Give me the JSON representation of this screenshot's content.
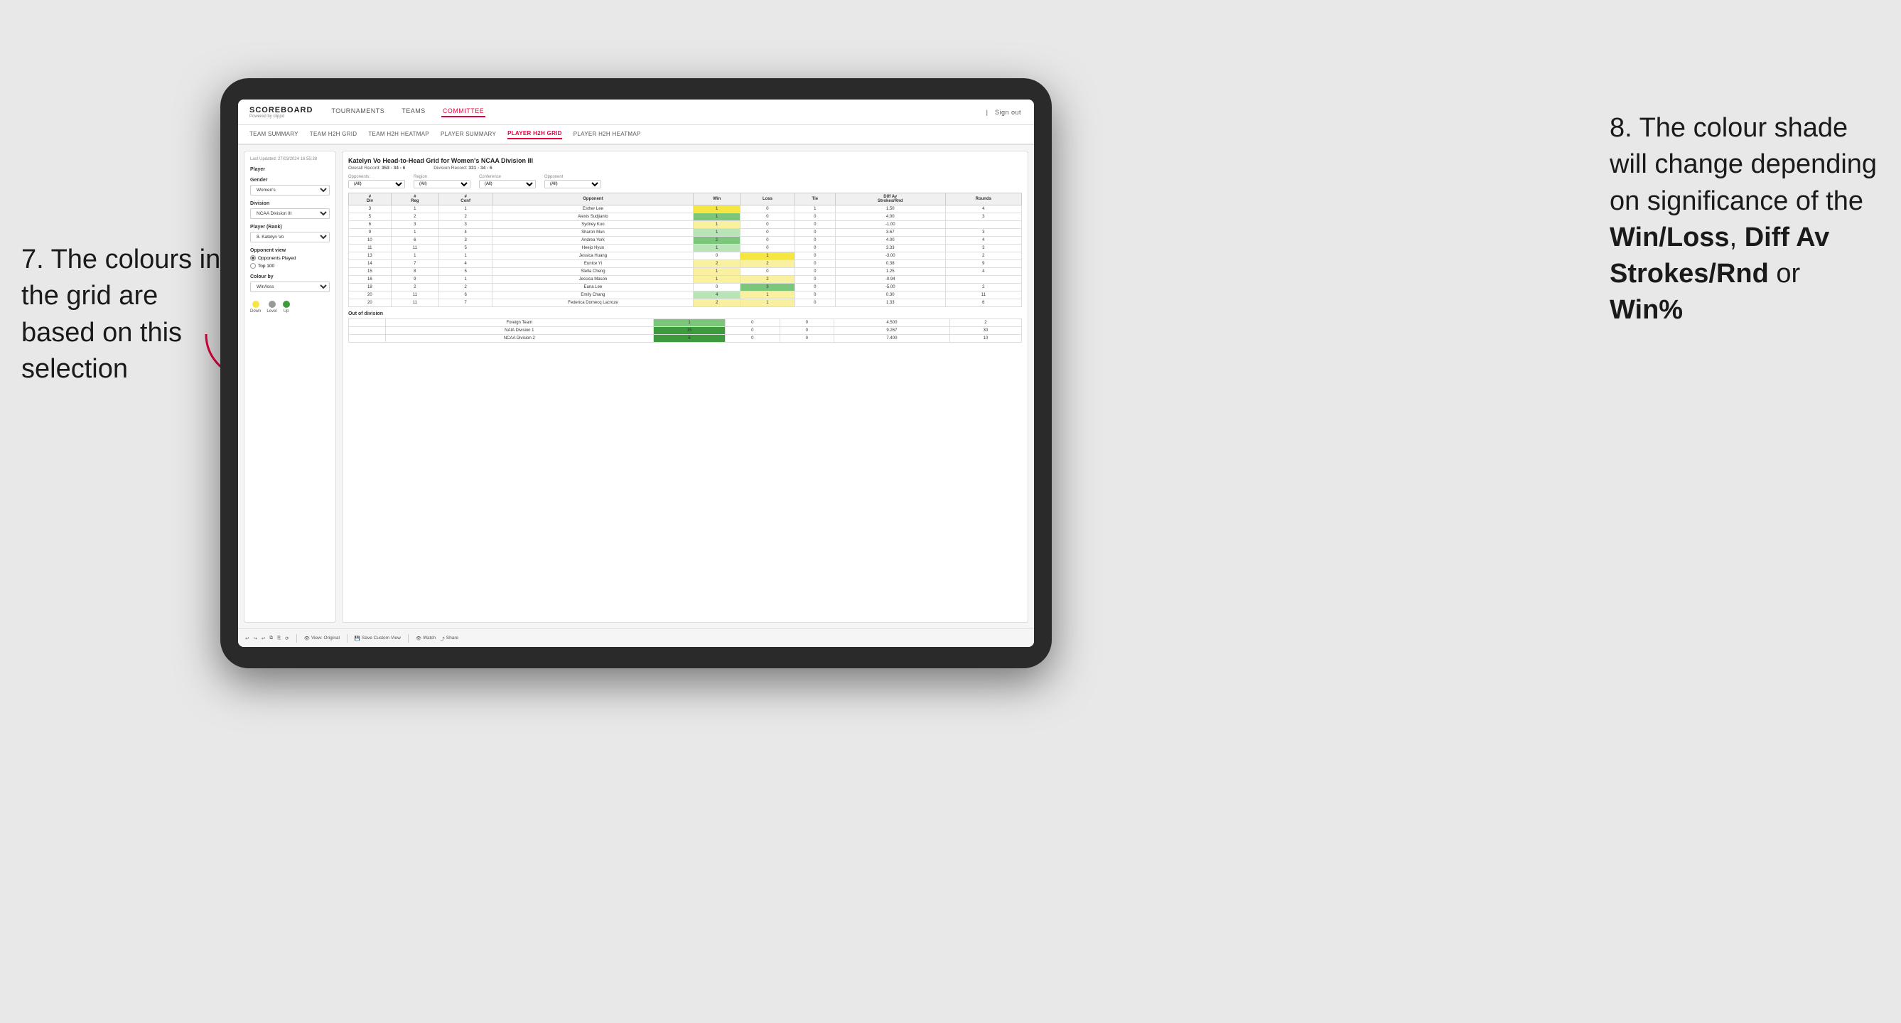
{
  "annotations": {
    "left_title": "7. The colours in\nthe grid are based\non this selection",
    "right_title": "8. The colour\nshade will change\ndepending on\nsignificance of the",
    "right_bold1": "Win/Loss",
    "right_comma": ", ",
    "right_bold2": "Diff Av\nStrokes/Rnd",
    "right_or": " or",
    "right_bold3": "Win%"
  },
  "nav": {
    "logo": "SCOREBOARD",
    "logo_sub": "Powered by clippd",
    "items": [
      "TOURNAMENTS",
      "TEAMS",
      "COMMITTEE"
    ],
    "active_item": "COMMITTEE",
    "right_items": [
      "Sign out"
    ]
  },
  "sub_nav": {
    "items": [
      "TEAM SUMMARY",
      "TEAM H2H GRID",
      "TEAM H2H HEATMAP",
      "PLAYER SUMMARY",
      "PLAYER H2H GRID",
      "PLAYER H2H HEATMAP"
    ],
    "active": "PLAYER H2H GRID"
  },
  "sidebar": {
    "timestamp": "Last Updated: 27/03/2024\n16:55:38",
    "player_label": "Player",
    "gender_label": "Gender",
    "gender_value": "Women's",
    "division_label": "Division",
    "division_value": "NCAA Division III",
    "player_rank_label": "Player (Rank)",
    "player_rank_value": "8. Katelyn Vo",
    "opponent_view_label": "Opponent view",
    "opponent_played": "Opponents Played",
    "top_100": "Top 100",
    "colour_by_label": "Colour by",
    "colour_by_value": "Win/loss",
    "legend_down": "Down",
    "legend_level": "Level",
    "legend_up": "Up"
  },
  "grid": {
    "title": "Katelyn Vo Head-to-Head Grid for Women's NCAA Division III",
    "overall_record_label": "Overall Record:",
    "overall_record": "353 - 34 - 6",
    "division_record_label": "Division Record:",
    "division_record": "331 - 34 - 6",
    "opponents_label": "Opponents:",
    "opponents_value": "(All)",
    "region_label": "Region",
    "region_value": "(All)",
    "conference_label": "Conference",
    "conference_value": "(All)",
    "opponent_label": "Opponent",
    "opponent_value": "(All)",
    "columns": [
      "#\nDiv",
      "#\nReg",
      "#\nConf",
      "Opponent",
      "Win",
      "Loss",
      "Tie",
      "Diff Av\nStrokes/Rnd",
      "Rounds"
    ],
    "rows": [
      {
        "div": "3",
        "reg": "1",
        "conf": "1",
        "name": "Esther Lee",
        "win": 1,
        "loss": 0,
        "tie": 1,
        "diff": "1.50",
        "rounds": "4",
        "win_color": "yellow",
        "loss_color": "white",
        "tie_color": "white"
      },
      {
        "div": "5",
        "reg": "2",
        "conf": "2",
        "name": "Alexis Sudjianto",
        "win": 1,
        "loss": 0,
        "tie": 0,
        "diff": "4.00",
        "rounds": "3",
        "win_color": "green_med",
        "loss_color": "white",
        "tie_color": "white"
      },
      {
        "div": "6",
        "reg": "3",
        "conf": "3",
        "name": "Sydney Kuo",
        "win": 1,
        "loss": 0,
        "tie": 0,
        "diff": "-1.00",
        "rounds": "",
        "win_color": "yellow_light",
        "loss_color": "white",
        "tie_color": "white"
      },
      {
        "div": "9",
        "reg": "1",
        "conf": "4",
        "name": "Sharon Mun",
        "win": 1,
        "loss": 0,
        "tie": 0,
        "diff": "3.67",
        "rounds": "3",
        "win_color": "green_light",
        "loss_color": "white",
        "tie_color": "white"
      },
      {
        "div": "10",
        "reg": "6",
        "conf": "3",
        "name": "Andrea York",
        "win": 2,
        "loss": 0,
        "tie": 0,
        "diff": "4.00",
        "rounds": "4",
        "win_color": "green_med",
        "loss_color": "white",
        "tie_color": "white"
      },
      {
        "div": "11",
        "reg": "11",
        "conf": "5",
        "name": "Heejo Hyun",
        "win": 1,
        "loss": 0,
        "tie": 0,
        "diff": "3.33",
        "rounds": "3",
        "win_color": "green_light",
        "loss_color": "white",
        "tie_color": "white"
      },
      {
        "div": "13",
        "reg": "1",
        "conf": "1",
        "name": "Jessica Huang",
        "win": 0,
        "loss": 1,
        "tie": 0,
        "diff": "-3.00",
        "rounds": "2",
        "win_color": "white",
        "loss_color": "yellow",
        "tie_color": "white"
      },
      {
        "div": "14",
        "reg": "7",
        "conf": "4",
        "name": "Eunice Yi",
        "win": 2,
        "loss": 2,
        "tie": 0,
        "diff": "0.38",
        "rounds": "9",
        "win_color": "yellow_light",
        "loss_color": "yellow_light",
        "tie_color": "white"
      },
      {
        "div": "15",
        "reg": "8",
        "conf": "5",
        "name": "Stella Cheng",
        "win": 1,
        "loss": 0,
        "tie": 0,
        "diff": "1.25",
        "rounds": "4",
        "win_color": "yellow_light",
        "loss_color": "white",
        "tie_color": "white"
      },
      {
        "div": "16",
        "reg": "9",
        "conf": "1",
        "name": "Jessica Mason",
        "win": 1,
        "loss": 2,
        "tie": 0,
        "diff": "-0.94",
        "rounds": "",
        "win_color": "yellow_light",
        "loss_color": "yellow_light",
        "tie_color": "white"
      },
      {
        "div": "18",
        "reg": "2",
        "conf": "2",
        "name": "Euna Lee",
        "win": 0,
        "loss": 3,
        "tie": 0,
        "diff": "-5.00",
        "rounds": "2",
        "win_color": "white",
        "loss_color": "green_med",
        "tie_color": "white"
      },
      {
        "div": "20",
        "reg": "11",
        "conf": "6",
        "name": "Emily Chang",
        "win": 4,
        "loss": 1,
        "tie": 0,
        "diff": "0.30",
        "rounds": "11",
        "win_color": "green_light",
        "loss_color": "yellow_light",
        "tie_color": "white"
      },
      {
        "div": "20",
        "reg": "11",
        "conf": "7",
        "name": "Federica Domecq Lacroze",
        "win": 2,
        "loss": 1,
        "tie": 0,
        "diff": "1.33",
        "rounds": "6",
        "win_color": "yellow_light",
        "loss_color": "yellow_light",
        "tie_color": "white"
      }
    ],
    "out_of_division_label": "Out of division",
    "out_of_division_rows": [
      {
        "name": "Foreign Team",
        "win": 1,
        "loss": 0,
        "tie": 0,
        "diff": "4.500",
        "rounds": "2",
        "win_color": "green_med"
      },
      {
        "name": "NAIA Division 1",
        "win": 15,
        "loss": 0,
        "tie": 0,
        "diff": "9.267",
        "rounds": "30",
        "win_color": "green_dark"
      },
      {
        "name": "NCAA Division 2",
        "win": 5,
        "loss": 0,
        "tie": 0,
        "diff": "7.400",
        "rounds": "10",
        "win_color": "green_dark"
      }
    ]
  },
  "toolbar": {
    "view_original": "View: Original",
    "save_custom": "Save Custom View",
    "watch": "Watch",
    "share": "Share"
  }
}
